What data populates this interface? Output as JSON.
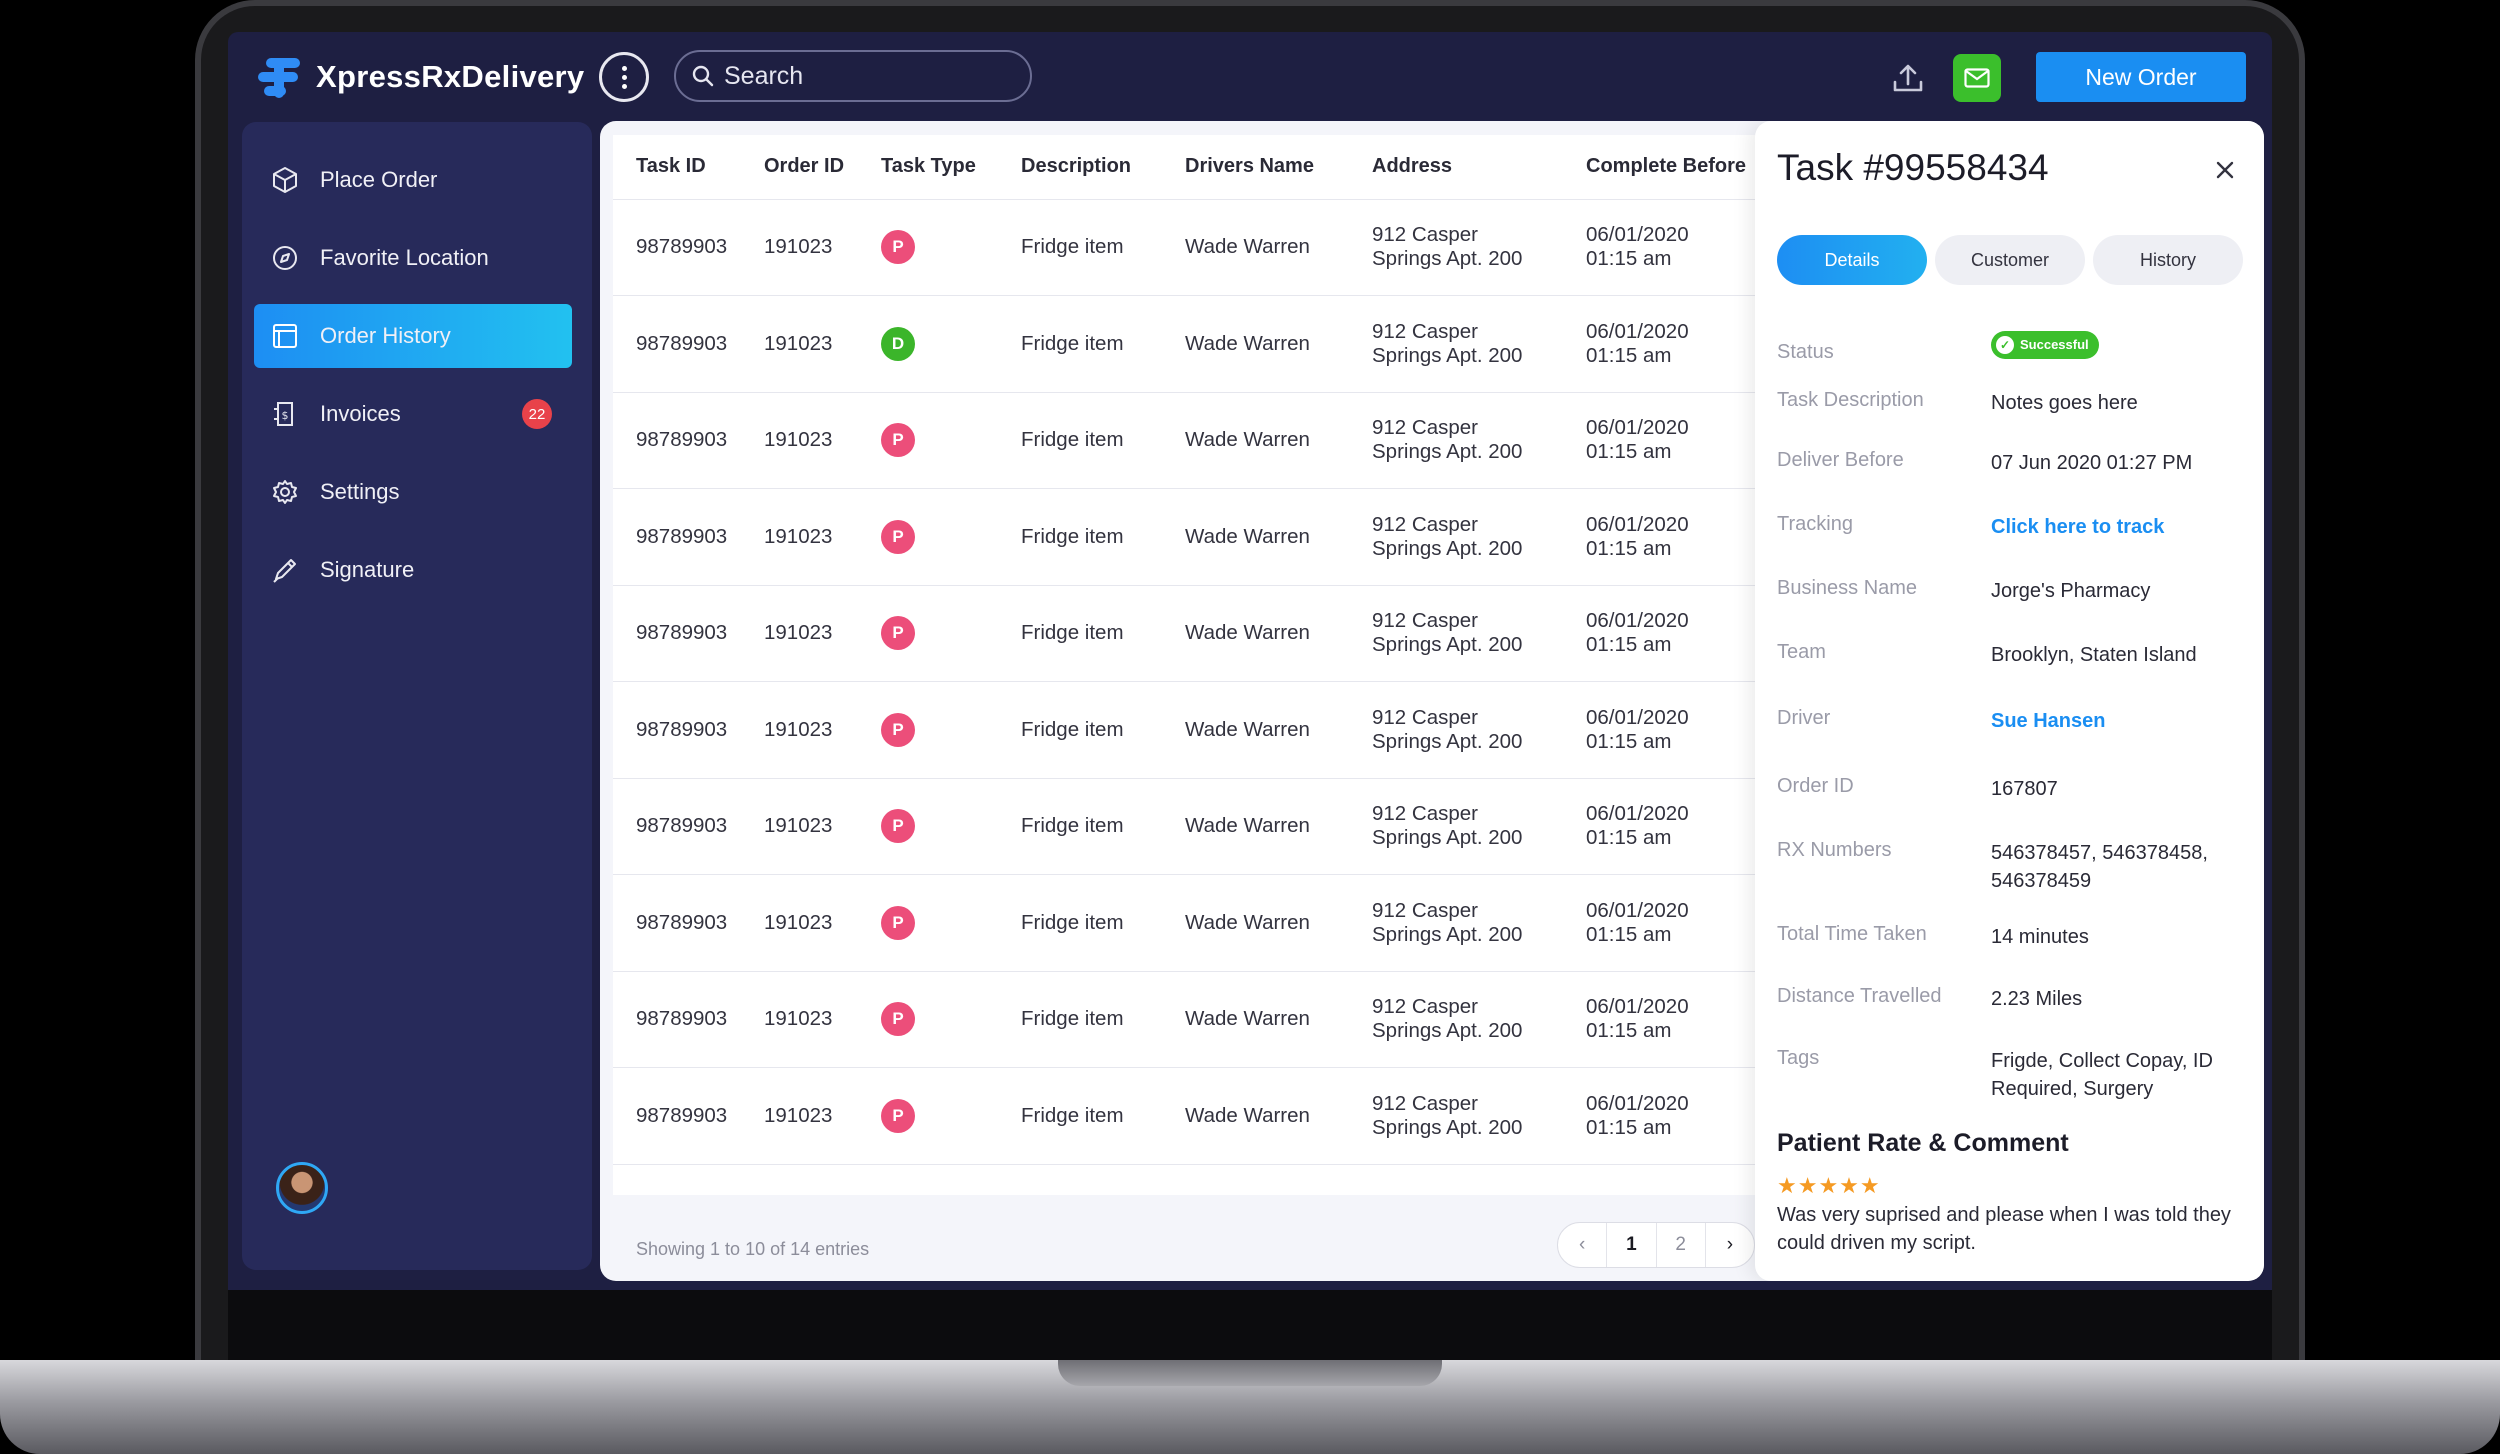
{
  "app": {
    "name": "XpressRxDelivery"
  },
  "header": {
    "search_placeholder": "Search",
    "new_order_label": "New Order",
    "accent_color": "#1a8ef2",
    "icons": [
      "more-icon",
      "search-icon",
      "upload-icon",
      "refresh-icon",
      "mail-icon"
    ]
  },
  "sidebar": {
    "items": [
      {
        "label": "Place Order",
        "icon": "box-icon"
      },
      {
        "label": "Favorite Location",
        "icon": "compass-icon"
      },
      {
        "label": "Order History",
        "icon": "archive-icon",
        "active": true
      },
      {
        "label": "Invoices",
        "icon": "invoice-icon",
        "badge": "22"
      },
      {
        "label": "Settings",
        "icon": "gear-icon"
      },
      {
        "label": "Signature",
        "icon": "pen-icon"
      }
    ]
  },
  "table": {
    "columns": [
      "Task ID",
      "Order ID",
      "Task Type",
      "Description",
      "Drivers Name",
      "Address",
      "Complete Before"
    ],
    "rows": [
      {
        "task_id": "98789903",
        "order_id": "191023",
        "type": "P",
        "description": "Fridge item",
        "driver": "Wade Warren",
        "address_1": "912 Casper",
        "address_2": "Springs Apt. 200",
        "date": "06/01/2020",
        "time": "01:15 am"
      },
      {
        "task_id": "98789903",
        "order_id": "191023",
        "type": "D",
        "description": "Fridge item",
        "driver": "Wade Warren",
        "address_1": "912 Casper",
        "address_2": "Springs Apt. 200",
        "date": "06/01/2020",
        "time": "01:15 am"
      },
      {
        "task_id": "98789903",
        "order_id": "191023",
        "type": "P",
        "description": "Fridge item",
        "driver": "Wade Warren",
        "address_1": "912 Casper",
        "address_2": "Springs Apt. 200",
        "date": "06/01/2020",
        "time": "01:15 am"
      },
      {
        "task_id": "98789903",
        "order_id": "191023",
        "type": "P",
        "description": "Fridge item",
        "driver": "Wade Warren",
        "address_1": "912 Casper",
        "address_2": "Springs Apt. 200",
        "date": "06/01/2020",
        "time": "01:15 am"
      },
      {
        "task_id": "98789903",
        "order_id": "191023",
        "type": "P",
        "description": "Fridge item",
        "driver": "Wade Warren",
        "address_1": "912 Casper",
        "address_2": "Springs Apt. 200",
        "date": "06/01/2020",
        "time": "01:15 am"
      },
      {
        "task_id": "98789903",
        "order_id": "191023",
        "type": "P",
        "description": "Fridge item",
        "driver": "Wade Warren",
        "address_1": "912 Casper",
        "address_2": "Springs Apt. 200",
        "date": "06/01/2020",
        "time": "01:15 am"
      },
      {
        "task_id": "98789903",
        "order_id": "191023",
        "type": "P",
        "description": "Fridge item",
        "driver": "Wade Warren",
        "address_1": "912 Casper",
        "address_2": "Springs Apt. 200",
        "date": "06/01/2020",
        "time": "01:15 am"
      },
      {
        "task_id": "98789903",
        "order_id": "191023",
        "type": "P",
        "description": "Fridge item",
        "driver": "Wade Warren",
        "address_1": "912 Casper",
        "address_2": "Springs Apt. 200",
        "date": "06/01/2020",
        "time": "01:15 am"
      },
      {
        "task_id": "98789903",
        "order_id": "191023",
        "type": "P",
        "description": "Fridge item",
        "driver": "Wade Warren",
        "address_1": "912 Casper",
        "address_2": "Springs Apt. 200",
        "date": "06/01/2020",
        "time": "01:15 am"
      },
      {
        "task_id": "98789903",
        "order_id": "191023",
        "type": "P",
        "description": "Fridge item",
        "driver": "Wade Warren",
        "address_1": "912 Casper",
        "address_2": "Springs Apt. 200",
        "date": "06/01/2020",
        "time": "01:15 am"
      }
    ],
    "footer_info": "Showing 1 to 10 of 14 entries",
    "pagination": {
      "prev": "‹",
      "pages": [
        "1",
        "2"
      ],
      "current": "1",
      "next": "›"
    }
  },
  "detail": {
    "title": "Task #99558434",
    "tabs": [
      "Details",
      "Customer",
      "History"
    ],
    "active_tab": "Details",
    "fields": {
      "status_label": "Status",
      "status_value": "Successful",
      "task_description_label": "Task Description",
      "task_description_value": "Notes goes here",
      "deliver_before_label": "Deliver Before",
      "deliver_before_value": "07 Jun 2020 01:27 PM",
      "tracking_label": "Tracking",
      "tracking_value": "Click here to track",
      "business_name_label": "Business Name",
      "business_name_value": "Jorge's Pharmacy",
      "team_label": "Team",
      "team_value": "Brooklyn, Staten Island",
      "driver_label": "Driver",
      "driver_value": "Sue Hansen",
      "order_id_label": "Order ID",
      "order_id_value": "167807",
      "rx_numbers_label": "RX Numbers",
      "rx_numbers_value": "546378457, 546378458, 546378459",
      "total_time_label": "Total Time Taken",
      "total_time_value": "14 minutes",
      "distance_label": "Distance Travelled",
      "distance_value": "2.23 Miles",
      "tags_label": "Tags",
      "tags_value": "Frigde, Collect Copay, ID Required, Surgery"
    },
    "rating_title": "Patient Rate & Comment",
    "rating": "5 of 5",
    "stars": "★★★★★",
    "comment": "Was very suprised and please when I was told they could driven my script."
  }
}
